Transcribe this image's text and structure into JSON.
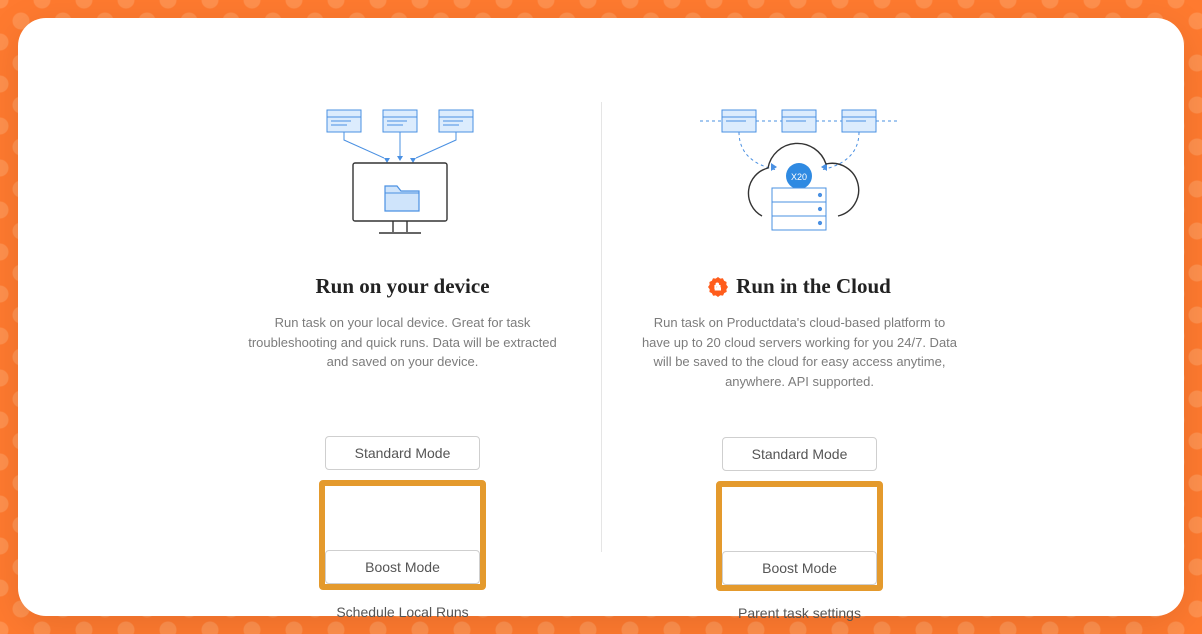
{
  "local": {
    "title": "Run on your device",
    "desc": "Run task on your local device. Great for task troubleshooting and quick runs. Data will be extracted and saved on your device.",
    "standard_label": "Standard Mode",
    "boost_label": "Boost Mode",
    "link_label": "Schedule Local Runs"
  },
  "cloud": {
    "title": "Run in the Cloud",
    "desc": "Run task on Productdata's cloud-based platform to have up to 20 cloud servers working for you 24/7. Data will be saved to the cloud for easy access anytime, anywhere. API supported.",
    "standard_label": "Standard Mode",
    "boost_label": "Boost Mode",
    "link_label": "Parent task settings",
    "badge_text": "X20"
  }
}
